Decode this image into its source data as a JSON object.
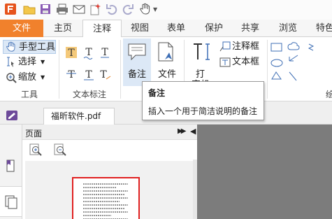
{
  "tabs": [
    "文件",
    "主页",
    "注释",
    "视图",
    "表单",
    "保护",
    "共享",
    "浏览",
    "特色"
  ],
  "active_tab": "注释",
  "ribbon": {
    "hand_tool": "手型工具",
    "select": "选择",
    "zoom": "缩放",
    "group_tools": "工具",
    "group_text_markup": "文本标注",
    "note": "备注",
    "file": "文件",
    "typewriter": "打",
    "typewriter_partial": "字机",
    "callout": "注释框",
    "textbox": "文本框",
    "group_drawing_partial": "绘"
  },
  "tooltip": {
    "title": "备注",
    "description": "插入一个用于简洁说明的备注"
  },
  "document": {
    "tab_name": "福昕软件.pdf"
  },
  "panel": {
    "title": "页面"
  },
  "colors": {
    "file_tab": "#f1812c",
    "selected": "#dce8f6",
    "thumb_border": "#e02020",
    "canvas": "#7c7c7c",
    "icon_blue": "#3f6fb5"
  },
  "icons": [
    "app-logo-icon",
    "open-folder-icon",
    "save-icon",
    "print-icon",
    "email-icon",
    "new-icon",
    "undo-icon",
    "redo-icon",
    "hand-icon",
    "dropdown-icon"
  ]
}
